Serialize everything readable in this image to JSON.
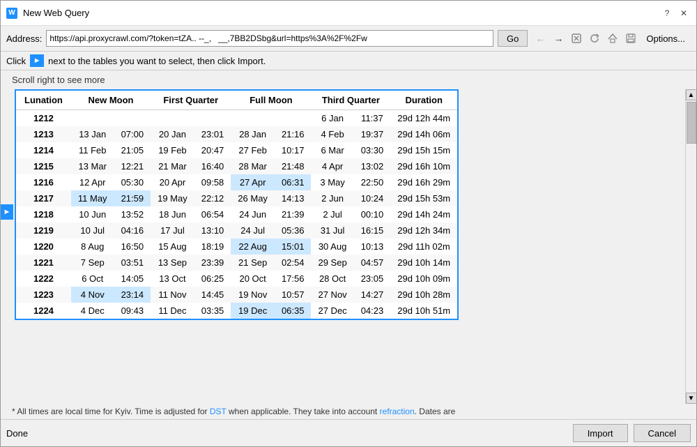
{
  "title": "New Web Query",
  "address": {
    "label": "Address:",
    "value": "https://api.proxycrawl.com/?token=tZA.. --_,   __,7BB2DSbg&url=https%3A%2F%2Fw",
    "go_button": "Go",
    "options_button": "Options..."
  },
  "click_bar": {
    "label": "Click",
    "instruction": "next to the tables you want to select, then click Import."
  },
  "scroll_hint": "Scroll right to see more",
  "table": {
    "headers": [
      "Lunation",
      "New Moon",
      "",
      "First Quarter",
      "",
      "Full Moon",
      "",
      "Third Quarter",
      "",
      "Duration"
    ],
    "rows": [
      {
        "lunation": "1212",
        "new_moon_date": "",
        "new_moon_time": "",
        "fq_date": "",
        "fq_time": "",
        "full_date": "",
        "full_time": "",
        "tq_date": "6 Jan",
        "tq_time": "11:37",
        "duration": "29d 12h 44m",
        "highlight": []
      },
      {
        "lunation": "1213",
        "new_moon_date": "13 Jan",
        "new_moon_time": "07:00",
        "fq_date": "20 Jan",
        "fq_time": "23:01",
        "full_date": "28 Jan",
        "full_time": "21:16",
        "tq_date": "4 Feb",
        "tq_time": "19:37",
        "duration": "29d 14h 06m",
        "highlight": []
      },
      {
        "lunation": "1214",
        "new_moon_date": "11 Feb",
        "new_moon_time": "21:05",
        "fq_date": "19 Feb",
        "fq_time": "20:47",
        "full_date": "27 Feb",
        "full_time": "10:17",
        "tq_date": "6 Mar",
        "tq_time": "03:30",
        "duration": "29d 15h 15m",
        "highlight": []
      },
      {
        "lunation": "1215",
        "new_moon_date": "13 Mar",
        "new_moon_time": "12:21",
        "fq_date": "21 Mar",
        "fq_time": "16:40",
        "full_date": "28 Mar",
        "full_time": "21:48",
        "tq_date": "4 Apr",
        "tq_time": "13:02",
        "duration": "29d 16h 10m",
        "highlight": []
      },
      {
        "lunation": "1216",
        "new_moon_date": "12 Apr",
        "new_moon_time": "05:30",
        "fq_date": "20 Apr",
        "fq_time": "09:58",
        "full_date": "27 Apr",
        "full_time": "06:31",
        "tq_date": "3 May",
        "tq_time": "22:50",
        "duration": "29d 16h 29m",
        "highlight": [
          "full"
        ]
      },
      {
        "lunation": "1217",
        "new_moon_date": "11 May",
        "new_moon_time": "21:59",
        "fq_date": "19 May",
        "fq_time": "22:12",
        "full_date": "26 May",
        "full_time": "14:13",
        "tq_date": "2 Jun",
        "tq_time": "10:24",
        "duration": "29d 15h 53m",
        "highlight": [
          "new"
        ]
      },
      {
        "lunation": "1218",
        "new_moon_date": "10 Jun",
        "new_moon_time": "13:52",
        "fq_date": "18 Jun",
        "fq_time": "06:54",
        "full_date": "24 Jun",
        "full_time": "21:39",
        "tq_date": "2 Jul",
        "tq_time": "00:10",
        "duration": "29d 14h 24m",
        "highlight": []
      },
      {
        "lunation": "1219",
        "new_moon_date": "10 Jul",
        "new_moon_time": "04:16",
        "fq_date": "17 Jul",
        "fq_time": "13:10",
        "full_date": "24 Jul",
        "full_time": "05:36",
        "tq_date": "31 Jul",
        "tq_time": "16:15",
        "duration": "29d 12h 34m",
        "highlight": []
      },
      {
        "lunation": "1220",
        "new_moon_date": "8 Aug",
        "new_moon_time": "16:50",
        "fq_date": "15 Aug",
        "fq_time": "18:19",
        "full_date": "22 Aug",
        "full_time": "15:01",
        "tq_date": "30 Aug",
        "tq_time": "10:13",
        "duration": "29d 11h 02m",
        "highlight": [
          "full"
        ]
      },
      {
        "lunation": "1221",
        "new_moon_date": "7 Sep",
        "new_moon_time": "03:51",
        "fq_date": "13 Sep",
        "fq_time": "23:39",
        "full_date": "21 Sep",
        "full_time": "02:54",
        "tq_date": "29 Sep",
        "tq_time": "04:57",
        "duration": "29d 10h 14m",
        "highlight": []
      },
      {
        "lunation": "1222",
        "new_moon_date": "6 Oct",
        "new_moon_time": "14:05",
        "fq_date": "13 Oct",
        "fq_time": "06:25",
        "full_date": "20 Oct",
        "full_time": "17:56",
        "tq_date": "28 Oct",
        "tq_time": "23:05",
        "duration": "29d 10h 09m",
        "highlight": []
      },
      {
        "lunation": "1223",
        "new_moon_date": "4 Nov",
        "new_moon_time": "23:14",
        "fq_date": "11 Nov",
        "fq_time": "14:45",
        "full_date": "19 Nov",
        "full_time": "10:57",
        "tq_date": "27 Nov",
        "tq_time": "14:27",
        "duration": "29d 10h 28m",
        "highlight": [
          "new"
        ]
      },
      {
        "lunation": "1224",
        "new_moon_date": "4 Dec",
        "new_moon_time": "09:43",
        "fq_date": "11 Dec",
        "fq_time": "03:35",
        "full_date": "19 Dec",
        "full_time": "06:35",
        "tq_date": "27 Dec",
        "tq_time": "04:23",
        "duration": "29d 10h 51m",
        "highlight": [
          "full"
        ]
      }
    ]
  },
  "footnote": "* All times are local time for Kyiv. Time is adjusted for DST when applicable. They take into account refraction. Dates are",
  "footnote_link": "DST",
  "footnote_link2": "refraction",
  "status": "Done",
  "import_button": "Import",
  "cancel_button": "Cancel"
}
